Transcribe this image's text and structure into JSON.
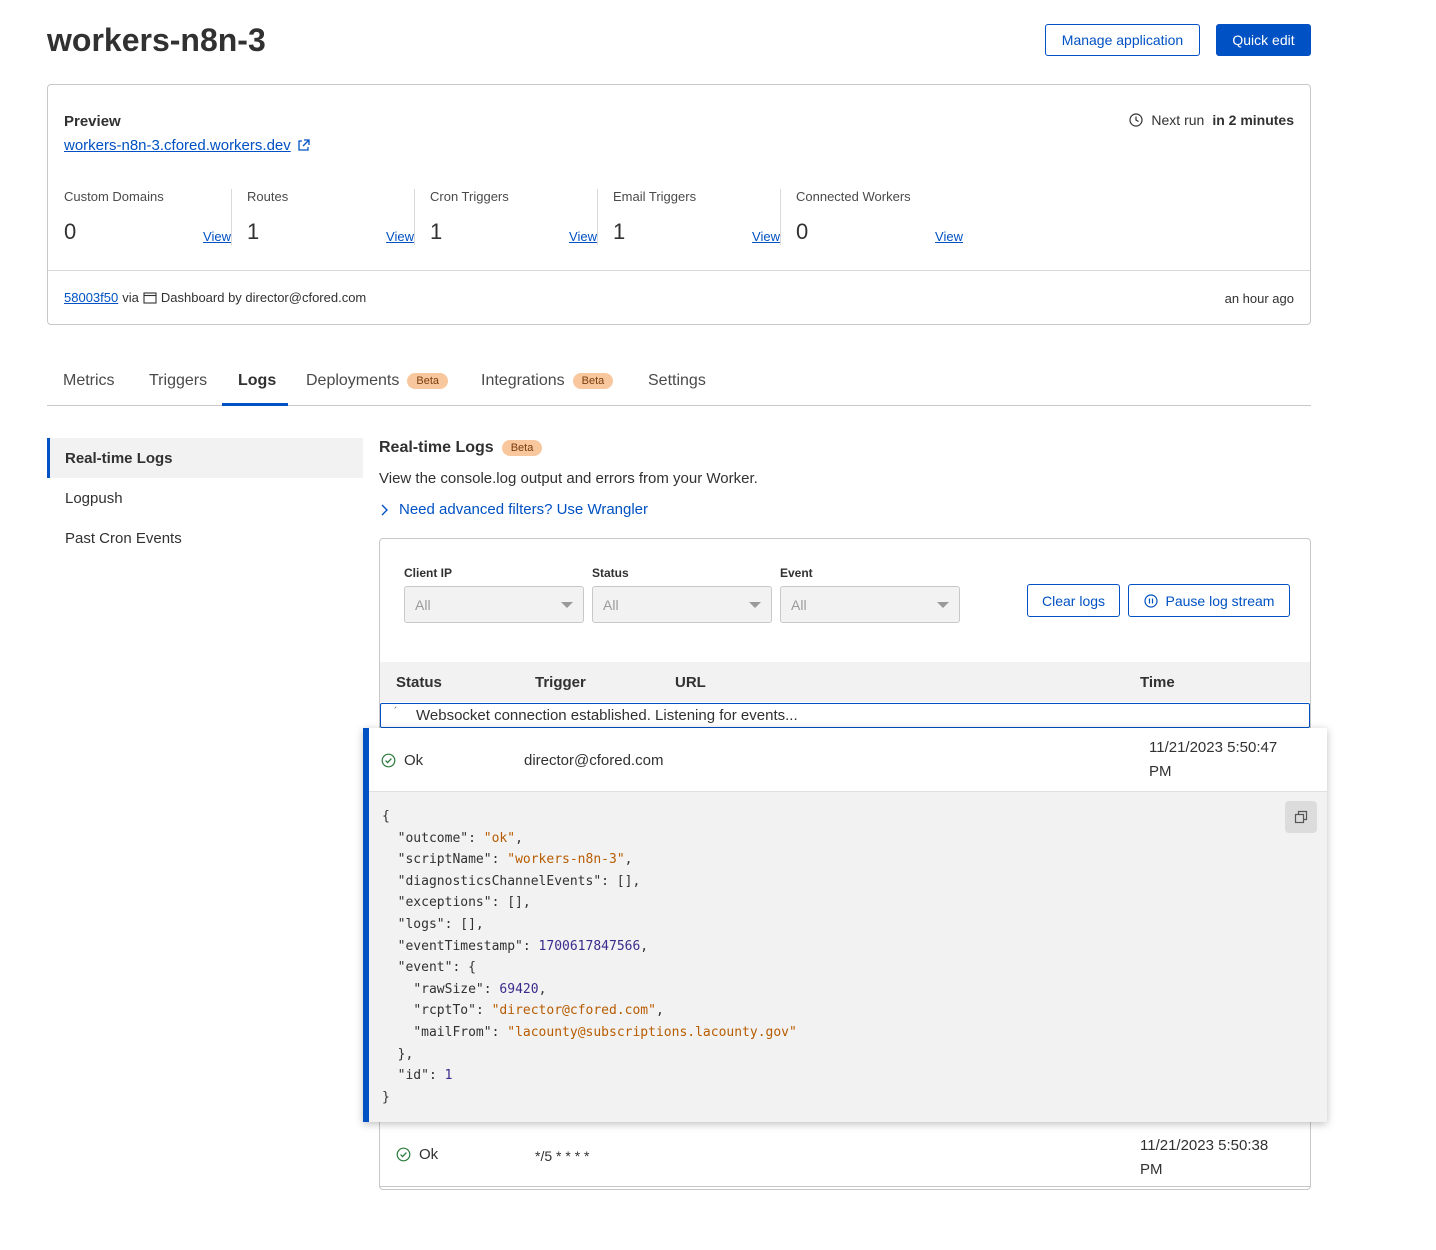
{
  "header": {
    "title": "workers-n8n-3",
    "manage_label": "Manage application",
    "quick_edit_label": "Quick edit"
  },
  "preview": {
    "label": "Preview",
    "url": "workers-n8n-3.cfored.workers.dev",
    "next_run_prefix": "Next run",
    "next_run_value": "in 2 minutes"
  },
  "stats": [
    {
      "label": "Custom Domains",
      "value": "0",
      "view": "View"
    },
    {
      "label": "Routes",
      "value": "1",
      "view": "View"
    },
    {
      "label": "Cron Triggers",
      "value": "1",
      "view": "View"
    },
    {
      "label": "Email Triggers",
      "value": "1",
      "view": "View"
    },
    {
      "label": "Connected Workers",
      "value": "0",
      "view": "View"
    }
  ],
  "deployment": {
    "hash": "58003f50",
    "via": "via",
    "source": "Dashboard by director@cfored.com",
    "time": "an hour ago"
  },
  "tabs": [
    {
      "label": "Metrics"
    },
    {
      "label": "Triggers"
    },
    {
      "label": "Logs"
    },
    {
      "label": "Deployments",
      "badge": "Beta"
    },
    {
      "label": "Integrations",
      "badge": "Beta"
    },
    {
      "label": "Settings"
    }
  ],
  "sidenav": [
    "Real-time Logs",
    "Logpush",
    "Past Cron Events"
  ],
  "realtime": {
    "title": "Real-time Logs",
    "badge": "Beta",
    "description": "View the console.log output and errors from your Worker.",
    "advanced_link": "Need advanced filters? Use Wrangler"
  },
  "filters": [
    {
      "label": "Client IP",
      "value": "All"
    },
    {
      "label": "Status",
      "value": "All"
    },
    {
      "label": "Event",
      "value": "All"
    }
  ],
  "actions": {
    "clear": "Clear logs",
    "pause": "Pause log stream"
  },
  "table": {
    "columns": [
      "Status",
      "Trigger",
      "URL",
      "Time"
    ],
    "websocket_msg": "Websocket connection established. Listening for events...",
    "tick": "´"
  },
  "log_expanded": {
    "status": "Ok",
    "trigger": "director@cfored.com",
    "time_line1": "11/21/2023 5:50:47",
    "time_line2": "PM",
    "json": {
      "outcome": "ok",
      "scriptName": "workers-n8n-3",
      "eventTimestamp": "1700617847566",
      "rawSize": "69420",
      "rcptTo": "director@cfored.com",
      "mailFrom": "lacounty@subscriptions.lacounty.gov",
      "id": "1"
    }
  },
  "log_row2": {
    "status": "Ok",
    "trigger": "*/5 * * * *",
    "time_line1": "11/21/2023 5:50:38",
    "time_line2": "PM"
  },
  "colors": {
    "accent": "#0051c3",
    "beta_badge": "#f9c79e",
    "ok_green": "#2a7a3b"
  }
}
